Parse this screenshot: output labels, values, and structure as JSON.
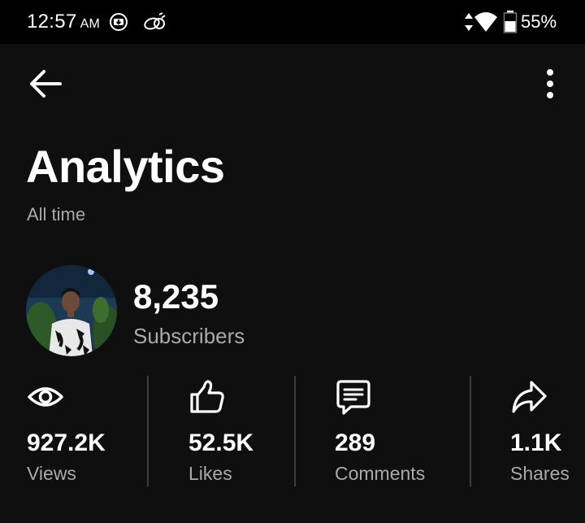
{
  "status_bar": {
    "time": "12:57",
    "ampm": "AM",
    "battery_percent": "55%",
    "icons": [
      "cast-download-icon",
      "signal-app-icon",
      "data-arrows-icon",
      "wifi-icon",
      "battery-icon"
    ]
  },
  "app_bar": {
    "back_icon": "arrow-left-icon",
    "more_icon": "more-vertical-icon"
  },
  "header": {
    "title": "Analytics",
    "subtitle": "All time"
  },
  "channel": {
    "subscriber_count": "8,235",
    "subscriber_label": "Subscribers"
  },
  "stats": [
    {
      "icon": "eye-icon",
      "value": "927.2K",
      "label": "Views"
    },
    {
      "icon": "thumbs-up-icon",
      "value": "52.5K",
      "label": "Likes"
    },
    {
      "icon": "comment-icon",
      "value": "289",
      "label": "Comments"
    },
    {
      "icon": "share-icon",
      "value": "1.1K",
      "label": "Shares"
    }
  ],
  "colors": {
    "background": "#0f0f0f",
    "status_bar": "#000000",
    "text_primary": "#ffffff",
    "text_secondary": "#aaaaaa",
    "divider": "#3d3d3d"
  }
}
